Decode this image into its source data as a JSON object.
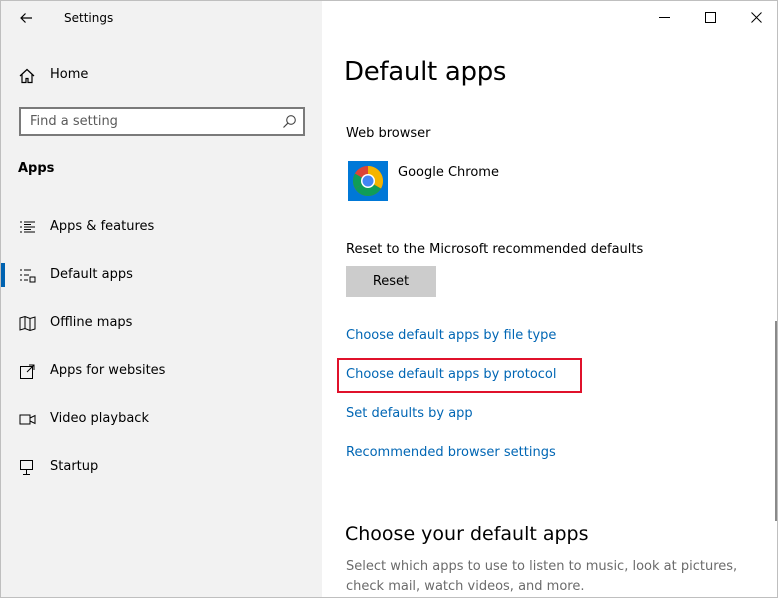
{
  "window": {
    "title": "Settings"
  },
  "sidebar": {
    "home_label": "Home",
    "search_placeholder": "Find a setting",
    "section_label": "Apps",
    "items": [
      {
        "label": "Apps & features",
        "icon": "list-icon",
        "active": false
      },
      {
        "label": "Default apps",
        "icon": "default-apps-icon",
        "active": true
      },
      {
        "label": "Offline maps",
        "icon": "map-icon",
        "active": false
      },
      {
        "label": "Apps for websites",
        "icon": "open-in-new-icon",
        "active": false
      },
      {
        "label": "Video playback",
        "icon": "video-icon",
        "active": false
      },
      {
        "label": "Startup",
        "icon": "startup-icon",
        "active": false
      }
    ]
  },
  "main": {
    "title": "Default apps",
    "web_browser_label": "Web browser",
    "browser_name": "Google Chrome",
    "reset_label": "Reset to the Microsoft recommended defaults",
    "reset_button": "Reset",
    "links": [
      "Choose default apps by file type",
      "Choose default apps by protocol",
      "Set defaults by app",
      "Recommended browser settings"
    ],
    "section_title": "Choose your default apps",
    "section_description": "Select which apps to use to listen to music, look at pictures, check mail, watch videos, and more."
  },
  "colors": {
    "accent": "#0063b1",
    "link": "#0066b4",
    "highlight": "#e0112b",
    "sidebar_bg": "#f2f2f2"
  }
}
